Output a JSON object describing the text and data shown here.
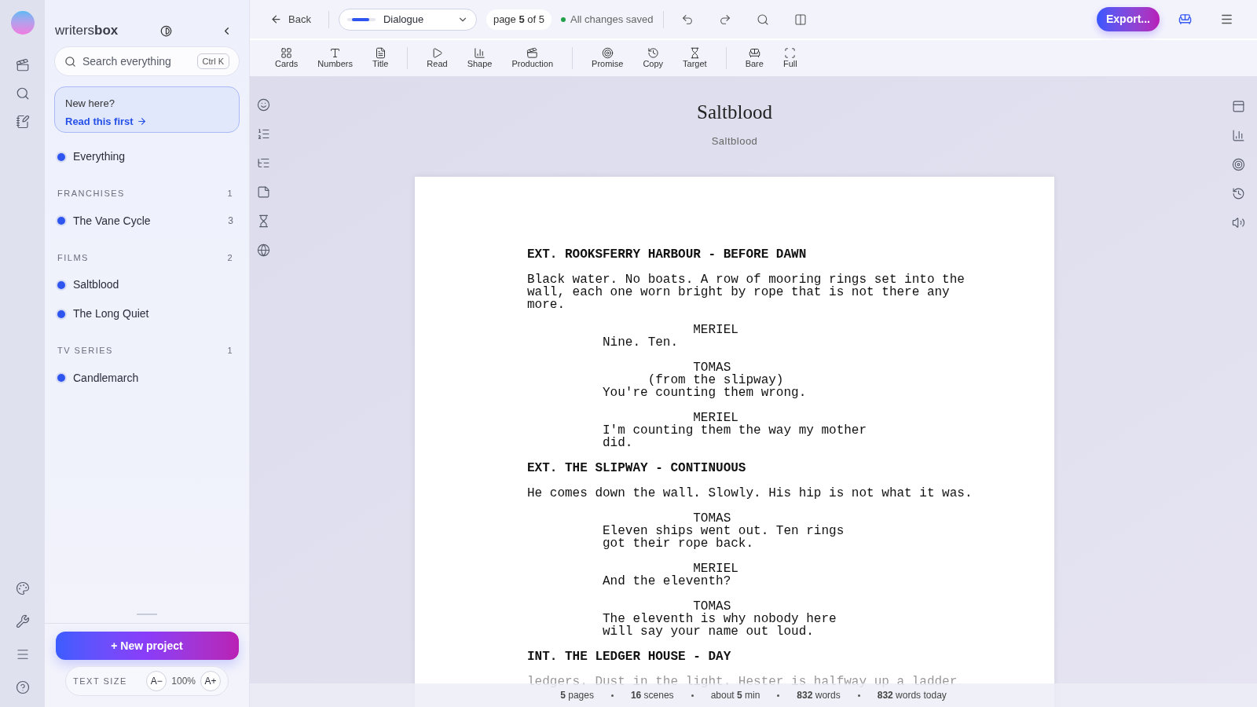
{
  "brand": "writers**box**",
  "search": {
    "placeholder": "Search everything",
    "shortcut": "Ctrl K"
  },
  "notice": {
    "title": "New here?",
    "link": "Read this first"
  },
  "everything": "Everything",
  "sections": [
    {
      "title": "FRANCHISES",
      "count": "1",
      "items": [
        {
          "label": "The Vane Cycle",
          "count": "3"
        }
      ]
    },
    {
      "title": "FILMS",
      "count": "2",
      "items": [
        {
          "label": "Saltblood"
        },
        {
          "label": "The Long Quiet"
        }
      ]
    },
    {
      "title": "TV SERIES",
      "count": "1",
      "items": [
        {
          "label": "Candlemarch"
        }
      ]
    }
  ],
  "new_project": "+ New project",
  "text_size": {
    "label": "TEXT SIZE",
    "decrease": "A−",
    "value": "100%",
    "increase": "A+"
  },
  "header": {
    "back": "Back",
    "mode": "Dialogue",
    "page": "page **5** of 5",
    "saved": "All changes saved",
    "export": "Export..."
  },
  "toolbar": [
    [
      "Cards",
      "Numbers",
      "Title"
    ],
    [
      "Read",
      "Shape",
      "Production"
    ],
    [
      "Promise",
      "Copy",
      "Target"
    ],
    [
      "Bare",
      "Full"
    ]
  ],
  "document": {
    "title": "Saltblood",
    "subtitle": "Saltblood"
  },
  "script": [
    {
      "kind": "scene",
      "text": "EXT. ROOKSFERRY HARBOUR - BEFORE DAWN"
    },
    {
      "kind": "action",
      "text": "Black water. No boats. A row of mooring rings set into the wall, each one worn bright by rope that is not there any more."
    },
    {
      "kind": "character",
      "text": "MERIEL"
    },
    {
      "kind": "dialogue",
      "text": "Nine. Ten."
    },
    {
      "kind": "character",
      "text": "TOMAS"
    },
    {
      "kind": "parenthetical",
      "text": "(from the slipway)"
    },
    {
      "kind": "dialogue",
      "text": "You're counting them wrong."
    },
    {
      "kind": "character",
      "text": "MERIEL"
    },
    {
      "kind": "dialogue",
      "text": "I'm counting them the way my mother did."
    },
    {
      "kind": "scene",
      "text": "EXT. THE SLIPWAY - CONTINUOUS"
    },
    {
      "kind": "action",
      "text": "He comes down the wall. Slowly. His hip is not what it was."
    },
    {
      "kind": "character",
      "text": "TOMAS"
    },
    {
      "kind": "dialogue",
      "text": "Eleven ships went out. Ten rings got their rope back."
    },
    {
      "kind": "character",
      "text": "MERIEL"
    },
    {
      "kind": "dialogue",
      "text": "And the eleventh?"
    },
    {
      "kind": "character",
      "text": "TOMAS"
    },
    {
      "kind": "dialogue",
      "text": "The eleventh is why nobody here will say your name out loud."
    },
    {
      "kind": "scene",
      "text": "INT. THE LEDGER HOUSE - DAY"
    },
    {
      "kind": "action",
      "text": "ledgers. Dust in the light. Hester is halfway up a ladder"
    }
  ],
  "status": [
    "**5** pages",
    "**16** scenes",
    "about **5** min",
    "**832** words",
    "**832** words today"
  ]
}
